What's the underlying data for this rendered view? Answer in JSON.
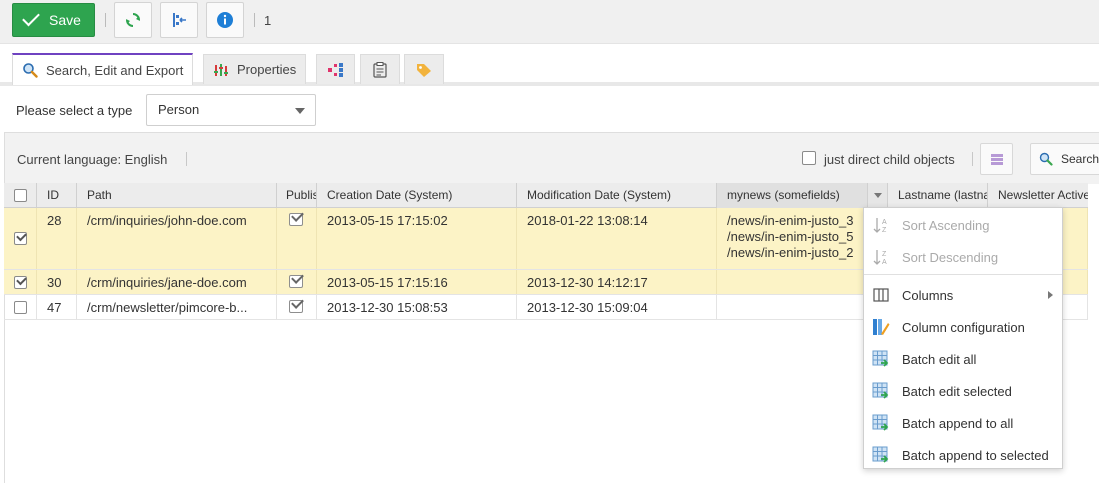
{
  "toolbar": {
    "save_label": "Save",
    "count": "1"
  },
  "tabs": [
    {
      "label": "Search, Edit and Export",
      "icon": "search-icon"
    },
    {
      "label": "Properties",
      "icon": "properties-icon"
    },
    {
      "label": "",
      "icon": "dependencies-icon"
    },
    {
      "label": "",
      "icon": "notes-icon"
    },
    {
      "label": "",
      "icon": "tag-icon"
    }
  ],
  "typebar": {
    "label": "Please select a type",
    "selected": "Person"
  },
  "subbar": {
    "language": "Current language: English",
    "child_objects_label": "just direct child objects",
    "search_label": "Search"
  },
  "grid": {
    "columns": [
      "ID",
      "Path",
      "Publis",
      "Creation Date (System)",
      "Modification Date (System)",
      "mynews (somefields)",
      "Lastname (lastna",
      "Newsletter Active"
    ],
    "rows": [
      {
        "selected": true,
        "id": "28",
        "path": "/crm/inquiries/john-doe.com",
        "created": "2013-05-15 17:15:02",
        "modified": "2018-01-22 13:08:14",
        "mynews": [
          "/news/in-enim-justo_3",
          "/news/in-enim-justo_5",
          "/news/in-enim-justo_2"
        ]
      },
      {
        "selected": true,
        "id": "30",
        "path": "/crm/inquiries/jane-doe.com",
        "created": "2013-05-15 17:15:16",
        "modified": "2013-12-30 14:12:17",
        "mynews": []
      },
      {
        "selected": false,
        "id": "47",
        "path": "/crm/newsletter/pimcore-b...",
        "created": "2013-12-30 15:08:53",
        "modified": "2013-12-30 15:09:04",
        "mynews": []
      }
    ]
  },
  "menu": {
    "sort_asc": "Sort Ascending",
    "sort_desc": "Sort Descending",
    "columns": "Columns",
    "column_config": "Column configuration",
    "batch_edit_all": "Batch edit all",
    "batch_edit_selected": "Batch edit selected",
    "batch_append_all": "Batch append to all",
    "batch_append_selected": "Batch append to selected"
  },
  "colors": {
    "save_green": "#2ea44f",
    "active_tab": "#6f42c1",
    "selected_row": "#fcf3c6",
    "info_blue": "#1f7fd6"
  }
}
